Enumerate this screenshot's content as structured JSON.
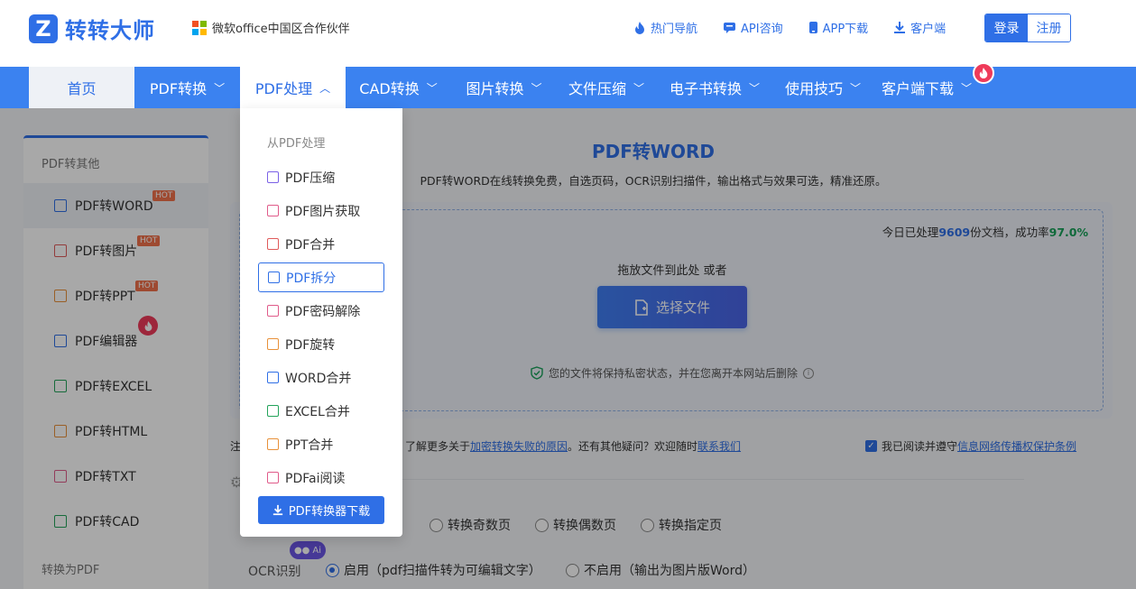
{
  "header": {
    "logo_mark": "Z",
    "logo_text": "转转大师",
    "partner_text": "微软office中国区合作伙伴",
    "links": [
      {
        "label": "热门导航",
        "icon": "fire-icon"
      },
      {
        "label": "API咨询",
        "icon": "chat-icon"
      },
      {
        "label": "APP下载",
        "icon": "phone-icon"
      },
      {
        "label": "客户端",
        "icon": "download-icon"
      }
    ],
    "login": "登录",
    "register": "注册"
  },
  "nav": {
    "items": [
      {
        "label": "首页"
      },
      {
        "label": "PDF转换"
      },
      {
        "label": "PDF处理"
      },
      {
        "label": "CAD转换"
      },
      {
        "label": "图片转换"
      },
      {
        "label": "文件压缩"
      },
      {
        "label": "电子书转换"
      },
      {
        "label": "使用技巧"
      },
      {
        "label": "客户端下载"
      }
    ]
  },
  "sidebar": {
    "section1": "PDF转其他",
    "items": [
      {
        "label": "PDF转WORD",
        "badge": "HOT",
        "color": "#2f6fe6"
      },
      {
        "label": "PDF转图片",
        "badge": "HOT",
        "color": "#e05b5b"
      },
      {
        "label": "PDF转PPT",
        "badge": "HOT",
        "color": "#e8913a"
      },
      {
        "label": "PDF编辑器",
        "badge": "",
        "color": "#2f6fe6"
      },
      {
        "label": "PDF转EXCEL",
        "badge": "",
        "color": "#23a35a"
      },
      {
        "label": "PDF转HTML",
        "badge": "",
        "color": "#e8913a"
      },
      {
        "label": "PDF转TXT",
        "badge": "",
        "color": "#e05b8a"
      },
      {
        "label": "PDF转CAD",
        "badge": "",
        "color": "#23a35a"
      }
    ],
    "section2": "转换为PDF"
  },
  "main": {
    "title": "PDF转WORD",
    "subtitle": "PDF转WORD在线转换免费，自选页码，OCR识别扫描件，输出格式与效果可选，精准还原。",
    "stats_prefix": "今日已处理",
    "stats_count": "9609",
    "stats_middle": "份文档，成功率",
    "stats_rate": "97.0%",
    "drop_text": "拖放文件到此处 或者",
    "select_button": "选择文件",
    "privacy": "您的文件将保持私密状态，并在您离开本网站后删除",
    "note_prefix": "注",
    "note_text": "了解更多关于",
    "note_link1": "加密转换失败的原因",
    "note_mid": "。还有其他疑问？欢迎随时",
    "note_link2": "联系我们",
    "agree_text": "我已阅读并遵守",
    "agree_link": "信息网络传播权保护条例",
    "page_options": [
      "转换奇数页",
      "转换偶数页",
      "转换指定页"
    ],
    "ocr_label": "OCR识别",
    "ocr_on": "启用（pdf扫描件转为可编辑文字）",
    "ocr_off": "不启用（输出为图片版Word）",
    "ai_badge": "Ai"
  },
  "dropdown": {
    "heading": "从PDF处理",
    "items": [
      {
        "label": "PDF压缩",
        "color": "#7b61e6"
      },
      {
        "label": "PDF图片获取",
        "color": "#e05b8a"
      },
      {
        "label": "PDF合并",
        "color": "#e05b5b"
      },
      {
        "label": "PDF拆分",
        "color": "#2f6fe6"
      },
      {
        "label": "PDF密码解除",
        "color": "#e05b8a"
      },
      {
        "label": "PDF旋转",
        "color": "#e8913a"
      },
      {
        "label": "WORD合并",
        "color": "#2f6fe6"
      },
      {
        "label": "EXCEL合并",
        "color": "#23a35a"
      },
      {
        "label": "PPT合并",
        "color": "#e8913a"
      },
      {
        "label": "PDFai阅读",
        "color": "#e05b8a"
      }
    ],
    "download_button": "PDF转换器下载"
  }
}
